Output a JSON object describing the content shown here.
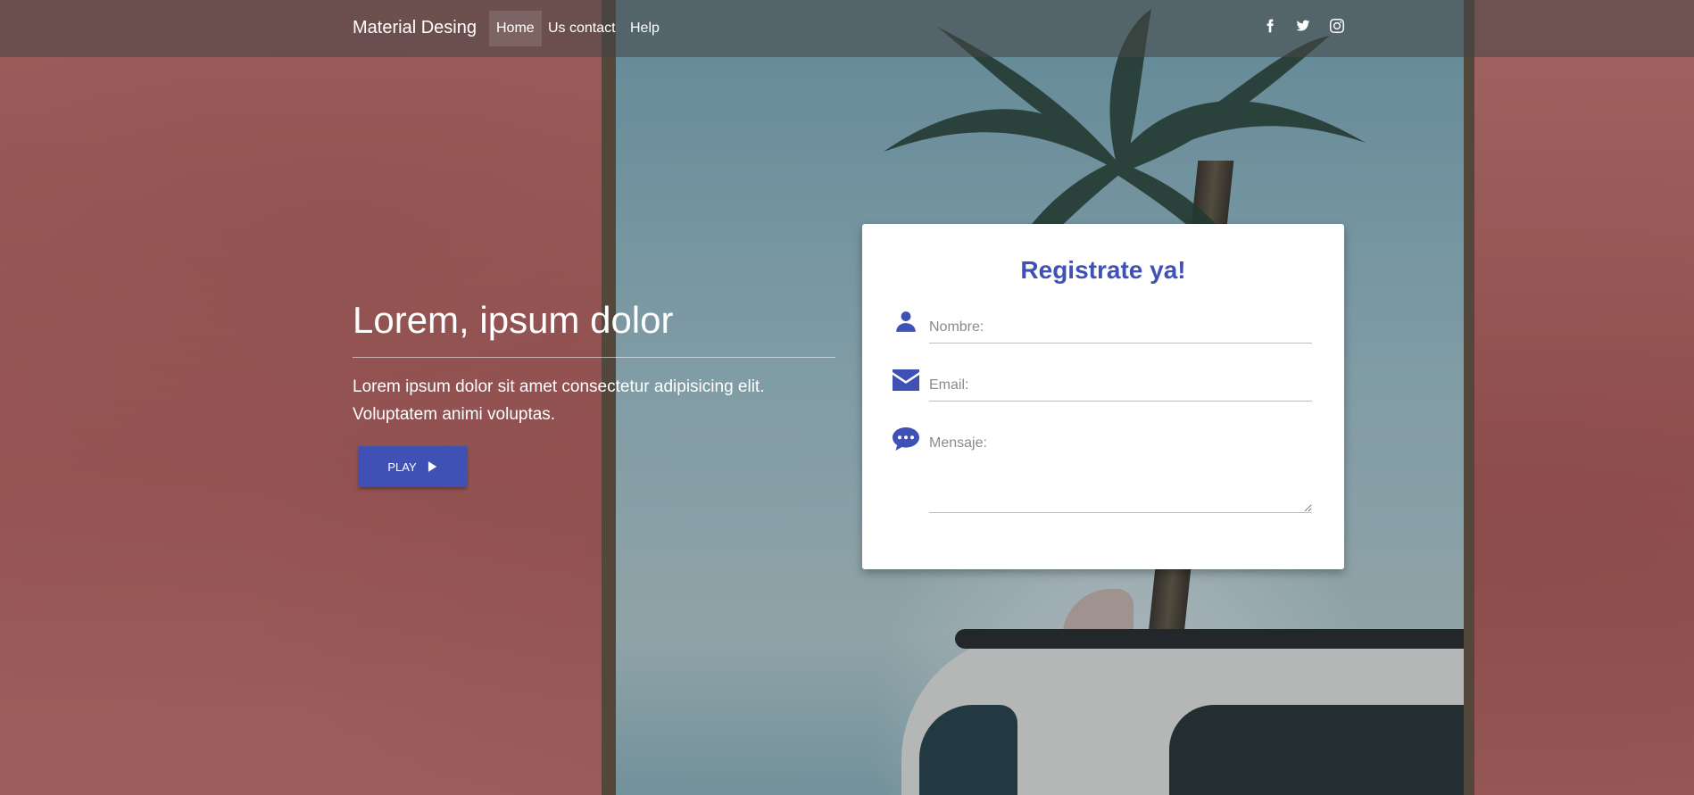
{
  "navbar": {
    "brand": "Material Desing",
    "items": [
      {
        "label": "Home",
        "active": true
      },
      {
        "label": "Us contact",
        "active": false
      },
      {
        "label": "Help",
        "active": false
      }
    ],
    "social_icons": [
      "facebook-icon",
      "twitter-icon",
      "instagram-icon"
    ]
  },
  "hero": {
    "title": "Lorem, ipsum dolor",
    "text": "Lorem ipsum dolor sit amet consectetur adipisicing elit. Voluptatem animi voluptas.",
    "play_label": "PLAY",
    "play_icon": "play-icon"
  },
  "form": {
    "title": "Registrate ya!",
    "fields": [
      {
        "icon": "user-icon",
        "placeholder": "Nombre:",
        "value": ""
      },
      {
        "icon": "envelope-icon",
        "placeholder": "Email:",
        "value": ""
      },
      {
        "icon": "comment-icon",
        "placeholder": "Mensaje:",
        "value": ""
      }
    ]
  },
  "colors": {
    "accent": "#3f51b5",
    "navbar_bg": "rgba(70,70,70,0.55)",
    "card_bg": "#ffffff"
  }
}
